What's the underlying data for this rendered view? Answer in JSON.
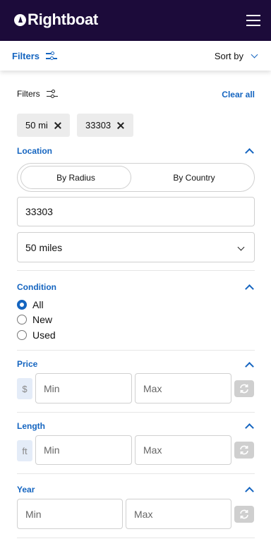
{
  "header": {
    "brand": "Rightboat",
    "menu_icon": "hamburger-menu-icon",
    "background": "#1c0b3a"
  },
  "toolbar": {
    "filters_label": "Filters",
    "sort_label": "Sort by",
    "accent": "#1565c0"
  },
  "filters_panel": {
    "title": "Filters",
    "clear_all": "Clear all",
    "chips": [
      {
        "label": "50 mi"
      },
      {
        "label": "33303"
      }
    ]
  },
  "location": {
    "label": "Location",
    "tabs": [
      "By Radius",
      "By Country"
    ],
    "selected_tab": "By Radius",
    "zip_value": "33303",
    "radius_value": "50 miles"
  },
  "condition": {
    "label": "Condition",
    "options": [
      "All",
      "New",
      "Used"
    ],
    "selected": "All"
  },
  "price": {
    "label": "Price",
    "unit": "$",
    "min_placeholder": "Min",
    "max_placeholder": "Max"
  },
  "length": {
    "label": "Length",
    "unit": "ft",
    "min_placeholder": "Min",
    "max_placeholder": "Max"
  },
  "year": {
    "label": "Year",
    "min_placeholder": "Min",
    "max_placeholder": "Max"
  }
}
